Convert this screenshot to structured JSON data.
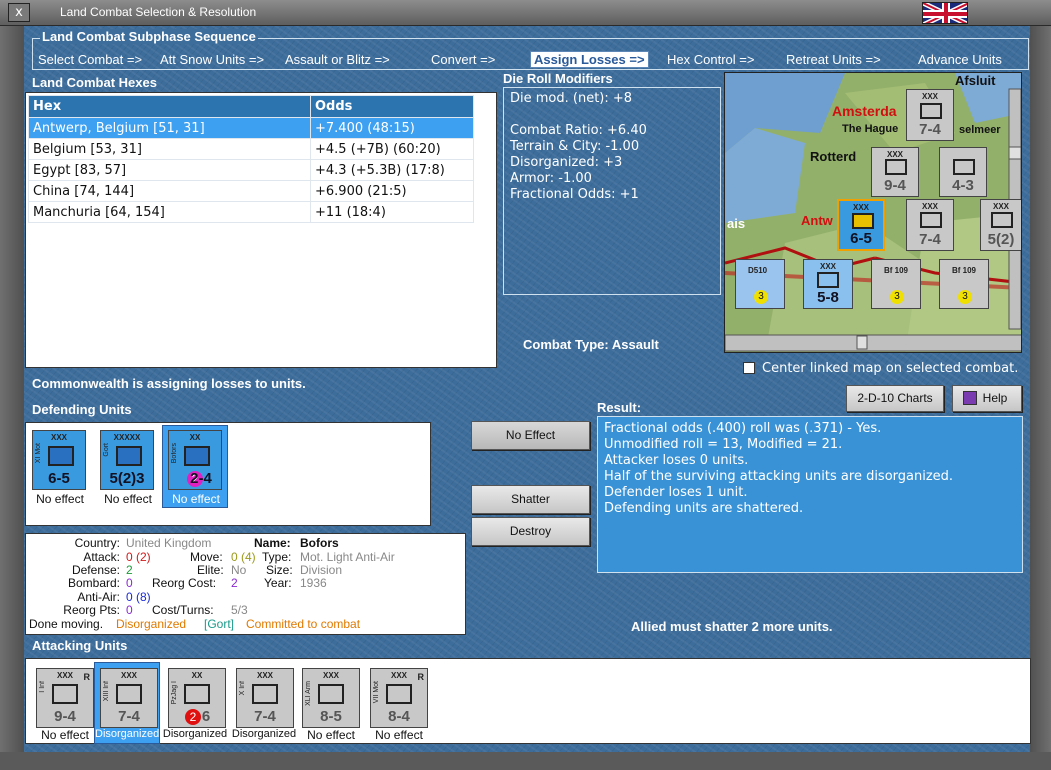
{
  "window": {
    "title": "Land Combat Selection & Resolution",
    "close_label": "x"
  },
  "sequence": {
    "title": "Land Combat Subphase Sequence",
    "steps": [
      "Select Combat =>",
      "Att Snow Units =>",
      "Assault or Blitz =>",
      "Convert =>",
      "Assign Losses =>",
      "Hex Control =>",
      "Retreat Units =>",
      "Advance Units"
    ],
    "active_index": 4
  },
  "hexes": {
    "title": "Land Combat Hexes",
    "col_hex": "Hex",
    "col_odds": "Odds",
    "rows": [
      {
        "hex": "Antwerp, Belgium [51, 31]",
        "odds": "+7.400 (48:15)"
      },
      {
        "hex": "Belgium [53, 31]",
        "odds": "+4.5 (+7B) (60:20)"
      },
      {
        "hex": "Egypt [83, 57]",
        "odds": "+4.3 (+5.3B) (17:8)"
      },
      {
        "hex": "China [74, 144]",
        "odds": "+6.900 (21:5)"
      },
      {
        "hex": "Manchuria [64, 154]",
        "odds": "+11 (18:4)"
      }
    ]
  },
  "die": {
    "title": "Die Roll Modifiers",
    "lines": [
      "Die mod. (net): +8",
      "",
      "Combat Ratio: +6.40",
      "Terrain & City: -1.00",
      "Disorganized: +3",
      "Armor: -1.00",
      "Fractional Odds: +1"
    ]
  },
  "combat_type": {
    "label": "Combat Type:",
    "value": "Assault"
  },
  "map": {
    "labels": [
      "Amsterda",
      "The Hague",
      "selmeer",
      "Rotterd",
      "Antw",
      "ais",
      "Afsluit"
    ],
    "units": [
      {
        "str": "7-4",
        "size": "XXX",
        "side": "I XII Inf"
      },
      {
        "str": "9-4",
        "size": "XXX",
        "side": "I Inf"
      },
      {
        "str": "4-3",
        "size": "",
        "side": "II Pz"
      },
      {
        "str": "6-5",
        "size": "XXX",
        "side": "XI Mot"
      },
      {
        "str": "7-4",
        "size": "XXX",
        "side": "X Inf"
      },
      {
        "str": "5(2)",
        "size": "XXX",
        "side": "Gort"
      },
      {
        "str": "5-8",
        "size": "XXX",
        "side": "VII Mot"
      },
      {
        "str": "3",
        "size": "D510",
        "side": ""
      },
      {
        "str": "3",
        "size": "Bf 109",
        "side": "Emil"
      },
      {
        "str": "3",
        "size": "Bf 109",
        "side": "Emil"
      }
    ],
    "center_linked_label": "Center linked map on selected combat."
  },
  "status_msg": "Commonwealth is assigning losses to units.",
  "buttons": {
    "charts": "2-D-10 Charts",
    "help": "Help",
    "no_effect": "No Effect",
    "shatter": "Shatter",
    "destroy": "Destroy"
  },
  "defending": {
    "title": "Defending Units",
    "units": [
      {
        "size": "XXX",
        "side": "XI Mot",
        "str": "6-5",
        "caption": "No effect",
        "selected": false
      },
      {
        "size": "XXXXX",
        "side": "Gort",
        "str": "5(2)3",
        "caption": "No effect",
        "selected": false
      },
      {
        "size": "XX",
        "side": "Bofors",
        "str": "2-4",
        "badge": "2",
        "caption": "No effect",
        "selected": true
      }
    ]
  },
  "result": {
    "title": "Result:",
    "lines": [
      "Fractional odds (.400) roll was (.371)  - Yes.",
      "Unmodified roll = 13, Modified = 21.",
      "Attacker loses 0 units.",
      "Half of the surviving attacking units are disorganized.",
      "Defender loses 1 unit.",
      "Defending units are shattered."
    ]
  },
  "info": {
    "country_k": "Country:",
    "country_v": "United Kingdom",
    "name_k": "Name:",
    "name_v": "Bofors",
    "attack_k": "Attack:",
    "attack_v": "0",
    "attack_v2": "(2)",
    "move_k": "Move:",
    "move_v": "0",
    "move_v2": "(4)",
    "type_k": "Type:",
    "type_v": "Mot. Light Anti-Air",
    "defense_k": "Defense:",
    "defense_v": "2",
    "elite_k": "Elite:",
    "elite_v": "No",
    "size_k": "Size:",
    "size_v": "Division",
    "bombard_k": "Bombard:",
    "bombard_v": "0",
    "reorg_k": "Reorg Cost:",
    "reorg_v": "2",
    "year_k": "Year:",
    "year_v": "1936",
    "antiair_k": "Anti-Air:",
    "antiair_v": "0",
    "antiair_v2": "(8)",
    "reorgpts_k": "Reorg Pts:",
    "reorgpts_v": "0",
    "cost_k": "Cost/Turns:",
    "cost_v": "5/3",
    "done_k": "Done moving.",
    "done_v1": "Disorganized",
    "done_v2": "[Gort]",
    "done_v3": "Committed to combat"
  },
  "allied_msg": "Allied must shatter 2 more units.",
  "attacking": {
    "title": "Attacking Units",
    "units": [
      {
        "size": "XXX",
        "side": "I Inf",
        "str": "9-4",
        "caption": "No effect",
        "selected": false
      },
      {
        "size": "XXX",
        "side": "XIII Inf",
        "str": "7-4",
        "caption": "Disorganized",
        "selected": true
      },
      {
        "size": "XX",
        "side": "PzJag I",
        "str": "6",
        "badge": "2",
        "caption": "Disorganized",
        "selected": false
      },
      {
        "size": "XXX",
        "side": "X Inf",
        "str": "7-4",
        "caption": "Disorganized",
        "selected": false
      },
      {
        "size": "XXX",
        "side": "XLI Arm",
        "str": "8-5",
        "caption": "No effect",
        "selected": false
      },
      {
        "size": "XXX",
        "side": "VII Mot",
        "str": "8-4",
        "caption": "No effect",
        "selected": false
      }
    ]
  }
}
